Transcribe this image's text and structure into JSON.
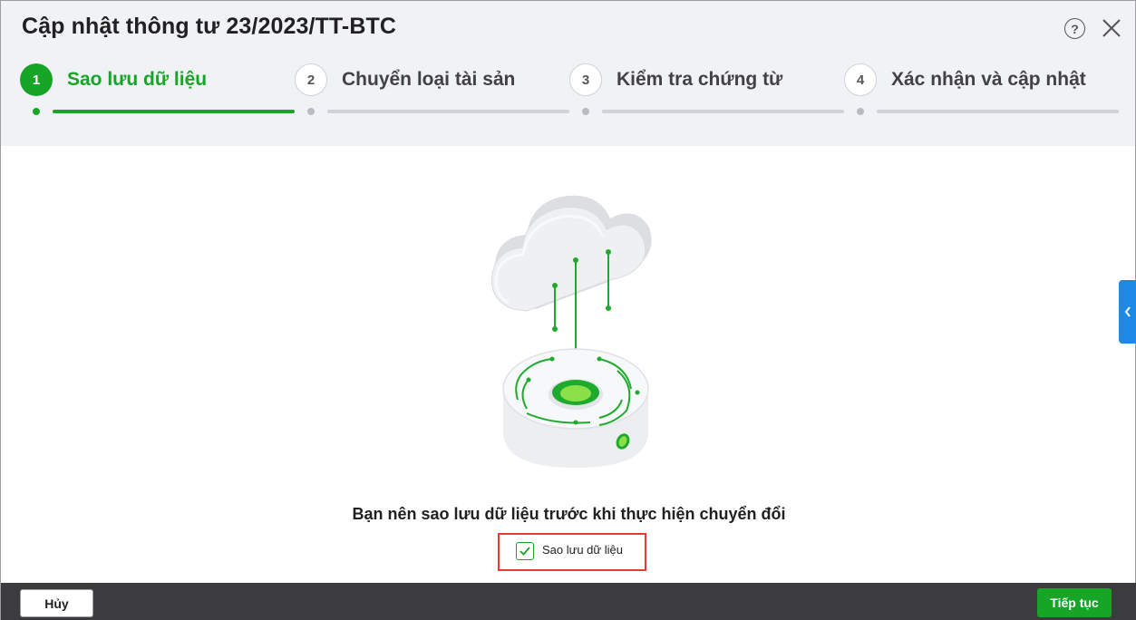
{
  "dialog": {
    "title": "Cập nhật thông tư 23/2023/TT-BTC",
    "help_glyph": "?",
    "help_icon": "question-circle-icon",
    "close_icon": "close-icon"
  },
  "steps": [
    {
      "number": "1",
      "label": "Sao lưu dữ liệu",
      "active": true
    },
    {
      "number": "2",
      "label": "Chuyển loại tài sản",
      "active": false
    },
    {
      "number": "3",
      "label": "Kiểm tra chứng từ",
      "active": false
    },
    {
      "number": "4",
      "label": "Xác nhận và cập nhật",
      "active": false
    }
  ],
  "body": {
    "illustration_icon": "cloud-backup-icon",
    "message": "Bạn nên sao lưu dữ liệu trước khi thực hiện chuyển đổi",
    "checkbox": {
      "label": "Sao lưu dữ liệu",
      "checked": true
    }
  },
  "side_tab": {
    "icon": "chevron-left-icon"
  },
  "footer": {
    "cancel_label": "Hủy",
    "next_label": "Tiếp tục"
  },
  "colors": {
    "accent": "#17a528",
    "header_bg": "#f0f2f5",
    "footer_bg": "#3c3c3e",
    "side_tab": "#1e88e5",
    "highlight_border": "#e53935"
  }
}
